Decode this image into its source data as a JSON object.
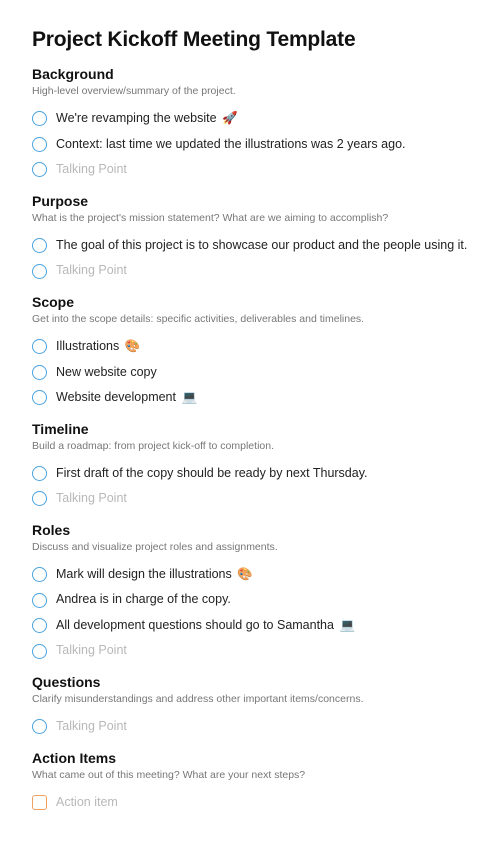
{
  "title": "Project Kickoff Meeting Template",
  "placeholder_talking": "Talking Point",
  "placeholder_action": "Action item",
  "emoji": {
    "rocket": "🚀",
    "palette": "🎨",
    "laptop": "💻"
  },
  "sections": [
    {
      "id": "background",
      "title": "Background",
      "desc": "High-level overview/summary of the project.",
      "items": [
        {
          "text": "We're revamping the website",
          "emoji": "rocket"
        },
        {
          "text": "Context: last time we updated the illustrations was 2 years ago."
        }
      ],
      "trailing_placeholder": "talking"
    },
    {
      "id": "purpose",
      "title": "Purpose",
      "desc": "What is the project's mission statement? What are we aiming to accomplish?",
      "items": [
        {
          "text": "The goal of this project is to showcase our product and the people using it."
        }
      ],
      "trailing_placeholder": "talking"
    },
    {
      "id": "scope",
      "title": "Scope",
      "desc": "Get into the scope details: specific activities, deliverables and timelines.",
      "items": [
        {
          "text": "Illustrations",
          "emoji": "palette"
        },
        {
          "text": "New website copy"
        },
        {
          "text": "Website development",
          "emoji": "laptop"
        }
      ]
    },
    {
      "id": "timeline",
      "title": "Timeline",
      "desc": "Build a roadmap: from project kick-off to completion.",
      "items": [
        {
          "text": "First draft of the copy should be ready by next Thursday."
        }
      ],
      "trailing_placeholder": "talking"
    },
    {
      "id": "roles",
      "title": "Roles",
      "desc": "Discuss and visualize project roles and assignments.",
      "items": [
        {
          "text": "Mark will design the illustrations",
          "emoji": "palette"
        },
        {
          "text": "Andrea is in charge of the copy."
        },
        {
          "text": "All development questions should go to Samantha",
          "emoji": "laptop"
        }
      ],
      "trailing_placeholder": "talking"
    },
    {
      "id": "questions",
      "title": "Questions",
      "desc": "Clarify misunderstandings and address other important items/concerns.",
      "items": [],
      "trailing_placeholder": "talking"
    },
    {
      "id": "action-items",
      "title": "Action Items",
      "desc": "What came out of this meeting? What are your next steps?",
      "items": [],
      "trailing_placeholder": "action"
    }
  ]
}
